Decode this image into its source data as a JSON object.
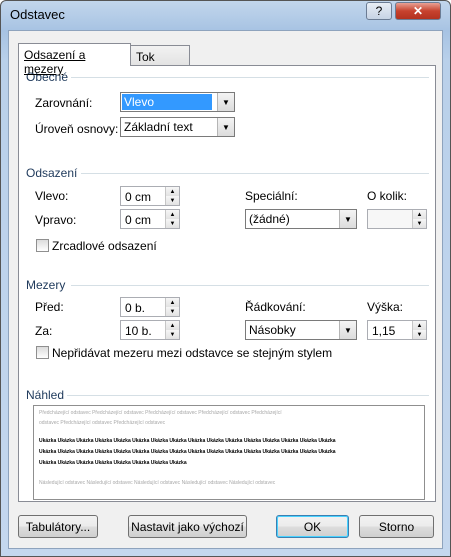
{
  "window": {
    "title": "Odstavec",
    "help_label": "?",
    "close_label": "✕"
  },
  "tabs": [
    {
      "label": "Odsazení a mezery"
    },
    {
      "label": "Tok textu"
    }
  ],
  "general": {
    "section_label": "Obecné",
    "alignment_label": "Zarovnání:",
    "alignment_value": "Vlevo",
    "outline_label": "Úroveň osnovy:",
    "outline_value": "Základní text"
  },
  "indent": {
    "section_label": "Odsazení",
    "left_label": "Vlevo:",
    "left_value": "0 cm",
    "right_label": "Vpravo:",
    "right_value": "0 cm",
    "special_label": "Speciální:",
    "special_value": "(žádné)",
    "by_label": "O kolik:",
    "by_value": "",
    "mirror_label": "Zrcadlové odsazení",
    "mirror_checked": false
  },
  "spacing": {
    "section_label": "Mezery",
    "before_label": "Před:",
    "before_value": "0 b.",
    "after_label": "Za:",
    "after_value": "10 b.",
    "line_label": "Řádkování:",
    "line_value": "Násobky",
    "at_label": "Výška:",
    "at_value": "1,15",
    "nospace_label": "Nepřidávat mezeru mezi odstavce se stejným stylem",
    "nospace_checked": false
  },
  "preview": {
    "section_label": "Náhled",
    "prev_line1": "Předcházející odstavec Předcházející odstavec Předcházející odstavec Předcházející odstavec Předcházející",
    "prev_line2": "odstavec Předcházející odstavec Předcházející odstavec",
    "sample_line1": "Ukázka Ukázka Ukázka Ukázka Ukázka Ukázka Ukázka Ukázka Ukázka Ukázka Ukázka Ukázka Ukázka Ukázka Ukázka Ukázka",
    "sample_line2": "Ukázka Ukázka Ukázka Ukázka Ukázka Ukázka Ukázka Ukázka Ukázka Ukázka Ukázka Ukázka Ukázka Ukázka Ukázka Ukázka",
    "sample_line3": "Ukázka Ukázka Ukázka Ukázka Ukázka Ukázka Ukázka Ukázka",
    "next_line1": "Následující odstavec Následující odstavec Následující odstavec Následující odstavec Následující odstavec"
  },
  "buttons": {
    "tabs": "Tabulátory...",
    "default": "Nastavit jako výchozí",
    "ok": "OK",
    "cancel": "Storno"
  }
}
